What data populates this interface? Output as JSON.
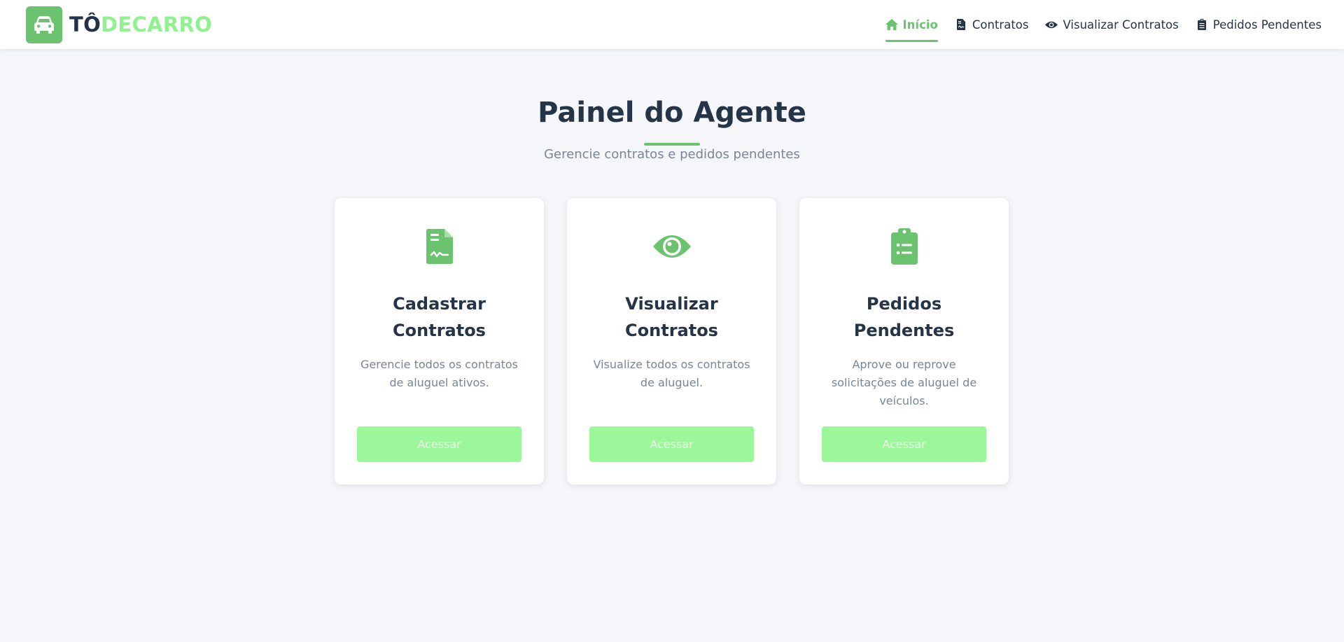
{
  "brand": {
    "part1": "TÔ",
    "part2": "DECARRO",
    "icon": "car-icon"
  },
  "nav": {
    "items": [
      {
        "label": "Início",
        "icon": "home-icon",
        "active": true
      },
      {
        "label": "Contratos",
        "icon": "file-contract-icon",
        "active": false
      },
      {
        "label": "Visualizar Contratos",
        "icon": "eye-icon",
        "active": false
      },
      {
        "label": "Pedidos Pendentes",
        "icon": "clipboard-icon",
        "active": false
      }
    ]
  },
  "main": {
    "title": "Painel do Agente",
    "subtitle": "Gerencie contratos e pedidos pendentes",
    "cards": [
      {
        "icon": "file-contract-icon",
        "title_line1": "Cadastrar",
        "title_line2": "Contratos",
        "description": "Gerencie todos os contratos de aluguel ativos.",
        "button": "Acessar"
      },
      {
        "icon": "eye-icon",
        "title_line1": "Visualizar",
        "title_line2": "Contratos",
        "description": "Visualize todos os contratos de aluguel.",
        "button": "Acessar"
      },
      {
        "icon": "clipboard-list-icon",
        "title_line1": "Pedidos",
        "title_line2": "Pendentes",
        "description": "Aprove ou reprove solicitações de aluguel de veículos.",
        "button": "Acessar"
      }
    ]
  },
  "colors": {
    "accent": "#6cc36f",
    "accent_light": "#8ff28f",
    "button": "#9cf69a",
    "text_dark": "#253446",
    "text_muted": "#7a8593",
    "background": "#f4f6f9"
  }
}
